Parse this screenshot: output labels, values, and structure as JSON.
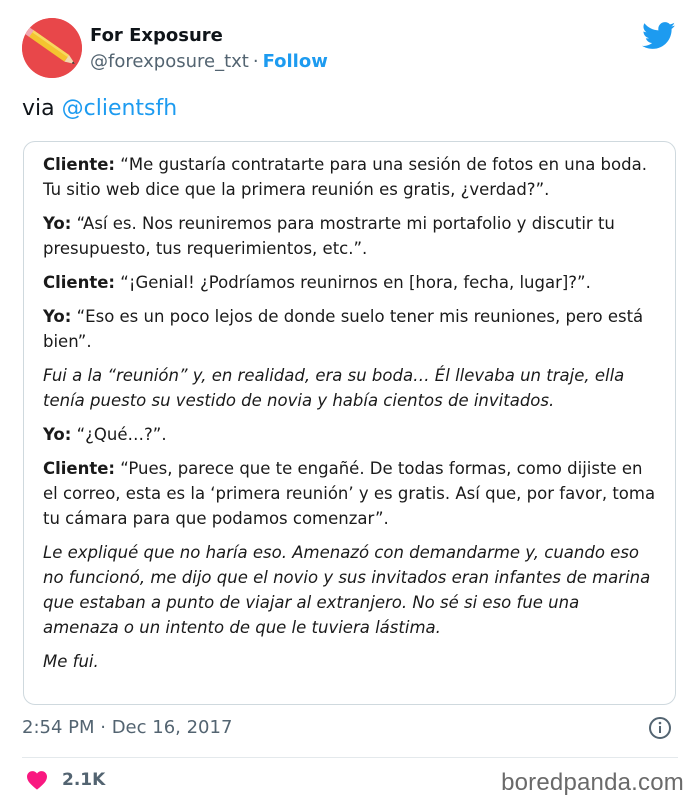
{
  "author": {
    "name": "For Exposure",
    "handle": "@forexposure_txt",
    "separator": "·",
    "follow_label": "Follow",
    "avatar_color": "#e8474a"
  },
  "tweet": {
    "via_prefix": "via",
    "via_mention": "@clientsfh"
  },
  "conversation": [
    {
      "speaker": "Cliente:",
      "text": "“Me gustaría contratarte para una sesión de fotos en una boda. Tu sitio web dice que la primera reunión es gratis, ¿verdad?”."
    },
    {
      "speaker": "Yo:",
      "text": "“Así es. Nos reuniremos para mostrarte mi portafolio y discutir tu presupuesto, tus requerimientos, etc.”."
    },
    {
      "speaker": "Cliente:",
      "text": "“¡Genial! ¿Podríamos reunirnos en [hora, fecha, lugar]?”."
    },
    {
      "speaker": "Yo:",
      "text": "“Eso es un poco lejos de donde suelo tener mis reuniones, pero está bien”."
    },
    {
      "narration": "Fui a la “reunión” y, en realidad, era su boda… Él llevaba un traje, ella tenía puesto su vestido de novia y había cientos de invitados."
    },
    {
      "speaker": "Yo:",
      "text": "“¿Qué…?”."
    },
    {
      "speaker": "Cliente:",
      "text": "“Pues, parece que te engañé. De todas formas, como dijiste en el correo, esta es la ‘primera reunión’ y es gratis. Así que, por favor, toma tu cámara para que podamos comenzar”."
    },
    {
      "narration": "Le expliqué que no haría eso. Amenazó con demandarme y, cuando eso no funcionó, me dijo que el novio y sus invitados eran infantes de marina que estaban a punto de viajar al extranjero. No sé si eso fue una amenaza o un intento de que le tuviera lástima."
    },
    {
      "narration": "Me fui."
    }
  ],
  "meta": {
    "timestamp": "2:54 PM · Dec 16, 2017"
  },
  "engagement": {
    "likes": "2.1K",
    "heart_color": "#f91880"
  },
  "watermark": "boredpanda.com",
  "colors": {
    "accent": "#1d9bf0",
    "muted_text": "#536471",
    "border": "#cfd9de"
  },
  "icons": [
    "twitter-bird-icon",
    "info-icon",
    "heart-icon",
    "pencil-icon"
  ]
}
